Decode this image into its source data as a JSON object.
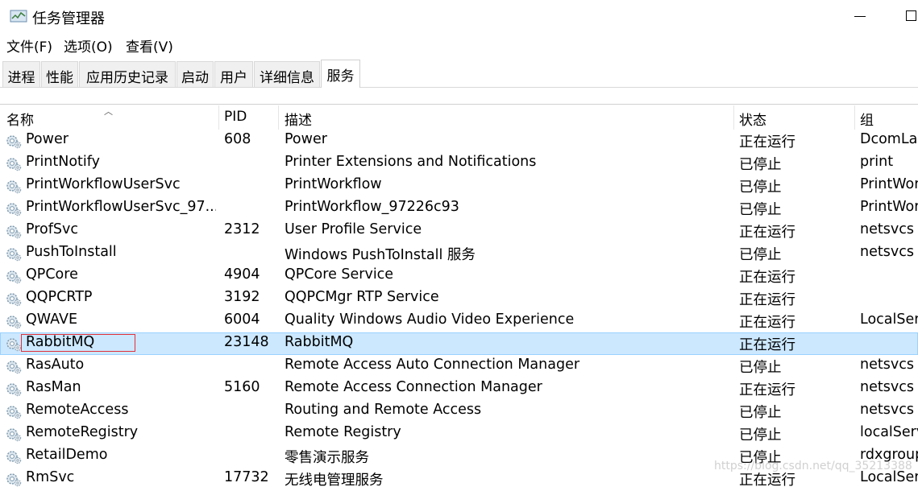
{
  "window": {
    "title": "任务管理器",
    "icon": "task-manager-icon"
  },
  "menu": {
    "items": [
      "文件(F)",
      "选项(O)",
      "查看(V)"
    ]
  },
  "tabs": [
    {
      "label": "进程",
      "active": false
    },
    {
      "label": "性能",
      "active": false
    },
    {
      "label": "应用历史记录",
      "active": false
    },
    {
      "label": "启动",
      "active": false
    },
    {
      "label": "用户",
      "active": false
    },
    {
      "label": "详细信息",
      "active": false
    },
    {
      "label": "服务",
      "active": true
    }
  ],
  "columns": {
    "name": "名称",
    "pid": "PID",
    "desc": "描述",
    "status": "状态",
    "group": "组"
  },
  "services": [
    {
      "name": "Power",
      "pid": "608",
      "desc": "Power",
      "status": "正在运行",
      "group": "DcomLau"
    },
    {
      "name": "PrintNotify",
      "pid": "",
      "desc": "Printer Extensions and Notifications",
      "status": "已停止",
      "group": "print"
    },
    {
      "name": "PrintWorkflowUserSvc",
      "pid": "",
      "desc": "PrintWorkflow",
      "status": "已停止",
      "group": "PrintWor"
    },
    {
      "name": "PrintWorkflowUserSvc_97...",
      "pid": "",
      "desc": "PrintWorkflow_97226c93",
      "status": "已停止",
      "group": "PrintWor"
    },
    {
      "name": "ProfSvc",
      "pid": "2312",
      "desc": "User Profile Service",
      "status": "正在运行",
      "group": "netsvcs"
    },
    {
      "name": "PushToInstall",
      "pid": "",
      "desc": "Windows PushToInstall 服务",
      "status": "已停止",
      "group": "netsvcs"
    },
    {
      "name": "QPCore",
      "pid": "4904",
      "desc": "QPCore Service",
      "status": "正在运行",
      "group": ""
    },
    {
      "name": "QQPCRTP",
      "pid": "3192",
      "desc": "QQPCMgr RTP Service",
      "status": "正在运行",
      "group": ""
    },
    {
      "name": "QWAVE",
      "pid": "6004",
      "desc": "Quality Windows Audio Video Experience",
      "status": "正在运行",
      "group": "LocalSer"
    },
    {
      "name": "RabbitMQ",
      "pid": "23148",
      "desc": "RabbitMQ",
      "status": "正在运行",
      "group": "",
      "selected": true
    },
    {
      "name": "RasAuto",
      "pid": "",
      "desc": "Remote Access Auto Connection Manager",
      "status": "已停止",
      "group": "netsvcs"
    },
    {
      "name": "RasMan",
      "pid": "5160",
      "desc": "Remote Access Connection Manager",
      "status": "正在运行",
      "group": "netsvcs"
    },
    {
      "name": "RemoteAccess",
      "pid": "",
      "desc": "Routing and Remote Access",
      "status": "已停止",
      "group": "netsvcs"
    },
    {
      "name": "RemoteRegistry",
      "pid": "",
      "desc": "Remote Registry",
      "status": "已停止",
      "group": "localServ"
    },
    {
      "name": "RetailDemo",
      "pid": "",
      "desc": "零售演示服务",
      "status": "已停止",
      "group": "rdxgroup"
    },
    {
      "name": "RmSvc",
      "pid": "17732",
      "desc": "无线电管理服务",
      "status": "正在运行",
      "group": "LocalSer"
    }
  ],
  "watermark": "https://blog.csdn.net/qq_35213388",
  "colors": {
    "selected_row": "#cce8ff",
    "highlight_box": "#e0303a"
  }
}
